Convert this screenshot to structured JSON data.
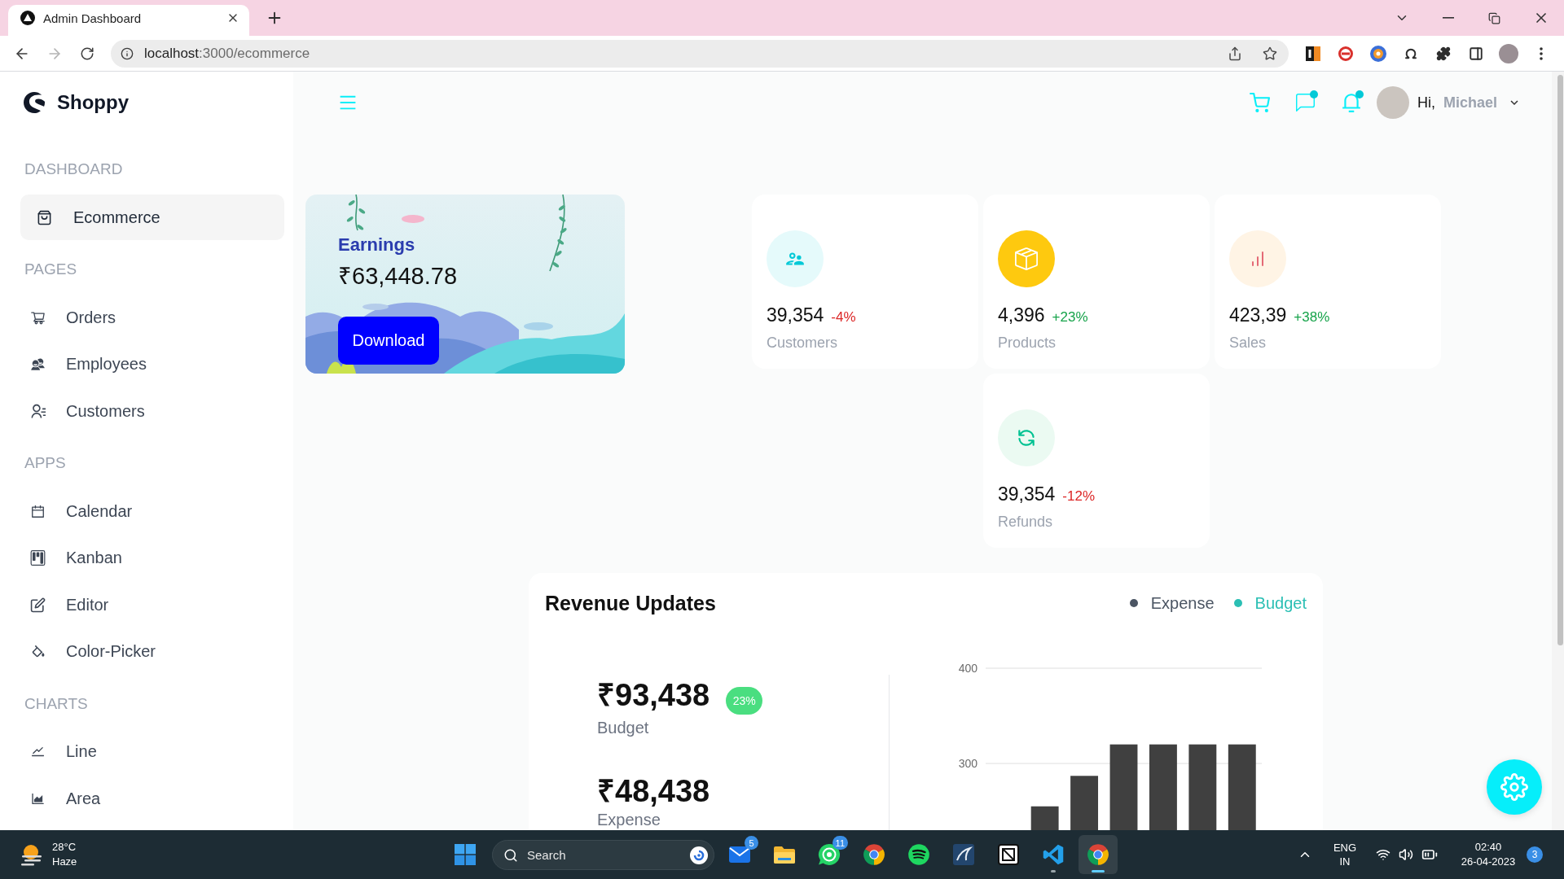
{
  "browser": {
    "tabs": [
      {
        "title": "Admin Dashboard",
        "selected": true
      }
    ],
    "forward_disabled": true,
    "url": {
      "host": "localhost",
      "path": ":3000/ecommerce"
    }
  },
  "sidebar": {
    "brand": "Shoppy",
    "sections": [
      {
        "title": "DASHBOARD",
        "items": [
          {
            "label": "Ecommerce",
            "selected": true
          }
        ]
      },
      {
        "title": "PAGES",
        "items": [
          {
            "label": "Orders",
            "selected": false
          },
          {
            "label": "Employees",
            "selected": false
          },
          {
            "label": "Customers",
            "selected": false
          }
        ]
      },
      {
        "title": "APPS",
        "items": [
          {
            "label": "Calendar",
            "selected": false
          },
          {
            "label": "Kanban",
            "selected": false
          },
          {
            "label": "Editor",
            "selected": false
          },
          {
            "label": "Color-Picker",
            "selected": false
          }
        ]
      },
      {
        "title": "CHARTS",
        "items": [
          {
            "label": "Line",
            "selected": false
          },
          {
            "label": "Area",
            "selected": false
          }
        ]
      }
    ]
  },
  "header": {
    "buttons": [
      {
        "notification": false
      },
      {
        "notification": true
      },
      {
        "notification": true
      }
    ],
    "greeting": "Hi,",
    "user": "Michael"
  },
  "earnings": {
    "title": "Earnings",
    "amount": "₹63,448.78",
    "button": "Download"
  },
  "stats": [
    {
      "amount": "39,354",
      "change": "-4%",
      "negative": true,
      "title": "Customers",
      "color": "#e5fafb"
    },
    {
      "amount": "4,396",
      "change": "+23%",
      "negative": false,
      "title": "Products",
      "color": "#fec90f"
    },
    {
      "amount": "423,39",
      "change": "+38%",
      "negative": false,
      "title": "Sales",
      "color": "#fff4e5"
    },
    {
      "amount": "39,354",
      "change": "-12%",
      "negative": true,
      "title": "Refunds",
      "color": "#ebfaf2"
    }
  ],
  "revenue": {
    "title": "Revenue Updates",
    "legend": [
      {
        "label": "Expense",
        "color": "#4b5563"
      },
      {
        "label": "Budget",
        "color": "#2bbfb4"
      }
    ],
    "budget": {
      "amount": "₹93,438",
      "badge": "23%",
      "label": "Budget"
    },
    "expense": {
      "amount": "₹48,438",
      "label": "Expense"
    },
    "chart_data": {
      "type": "bar",
      "series": [
        {
          "color": "#404040",
          "values": [
            null,
            255,
            287,
            320,
            320,
            320,
            320
          ]
        }
      ],
      "ylim": [
        230,
        400
      ],
      "yticks": [
        300,
        400
      ]
    }
  },
  "taskbar": {
    "weather": {
      "temperature": "28°C",
      "condition": "Haze"
    },
    "search": {
      "placeholder": "Search"
    },
    "apps": [
      {
        "badge": "5",
        "running": false,
        "selected": false
      },
      {
        "running": false,
        "selected": false
      },
      {
        "badge": "11",
        "running": false,
        "selected": false
      },
      {
        "running": false,
        "selected": false
      },
      {
        "running": false,
        "selected": false
      },
      {
        "running": false,
        "selected": false
      },
      {
        "running": false,
        "selected": false
      },
      {
        "running": true,
        "selected": false
      },
      {
        "running": true,
        "selected": true
      }
    ],
    "language": "ENG",
    "region": "IN",
    "time": "02:40",
    "date": "26-04-2023",
    "notifications": "3"
  }
}
